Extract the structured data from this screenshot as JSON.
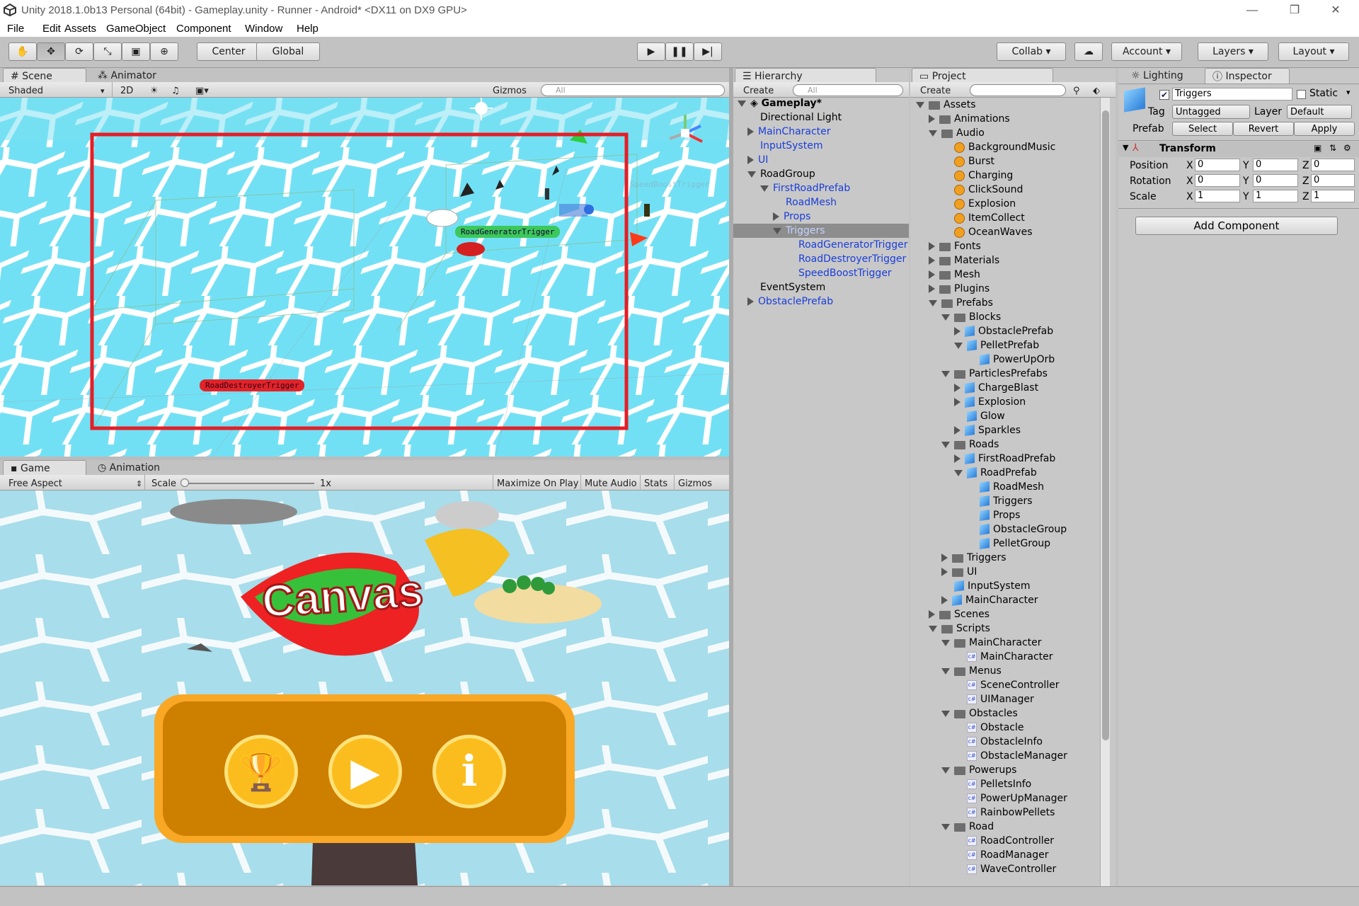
{
  "window": {
    "title": "Unity 2018.1.0b13 Personal (64bit) - Gameplay.unity - Runner - Android* <DX11 on DX9 GPU>"
  },
  "menu": [
    "File",
    "Edit",
    "Assets",
    "GameObject",
    "Component",
    "Window",
    "Help"
  ],
  "toolbar": {
    "pivot": "Center",
    "space": "Global",
    "collab": "Collab",
    "account": "Account",
    "layers": "Layers",
    "layout": "Layout"
  },
  "scene_panel": {
    "tab_scene": "Scene",
    "tab_animator": "Animator",
    "shading": "Shaded",
    "mode2d": "2D",
    "gizmos": "Gizmos",
    "search_placeholder": "All",
    "labels": {
      "road_generator": "RoadGeneratorTrigger",
      "road_destroyer": "RoadDestroyerTrigger",
      "speed_boost": "SpeedBoostTrigger"
    }
  },
  "game_panel": {
    "tab_game": "Game",
    "tab_animation": "Animation",
    "aspect": "Free Aspect",
    "scale_label": "Scale",
    "scale_value": "1x",
    "maximize": "Maximize On Play",
    "mute": "Mute Audio",
    "stats": "Stats",
    "gizmos": "Gizmos",
    "logo_text": "Canvas"
  },
  "hierarchy": {
    "tab": "Hierarchy",
    "create": "Create",
    "search_placeholder": "All",
    "scene": "Gameplay*",
    "items": [
      {
        "label": "Directional Light",
        "indent": 0,
        "arrow": "none",
        "blue": false
      },
      {
        "label": "MainCharacter",
        "indent": 0,
        "arrow": "right",
        "blue": true
      },
      {
        "label": "InputSystem",
        "indent": 0,
        "arrow": "none",
        "blue": true
      },
      {
        "label": "UI",
        "indent": 0,
        "arrow": "right",
        "blue": true
      },
      {
        "label": "RoadGroup",
        "indent": 0,
        "arrow": "down",
        "blue": false
      },
      {
        "label": "FirstRoadPrefab",
        "indent": 1,
        "arrow": "down",
        "blue": true
      },
      {
        "label": "RoadMesh",
        "indent": 2,
        "arrow": "none",
        "blue": true
      },
      {
        "label": "Props",
        "indent": 2,
        "arrow": "right",
        "blue": true
      },
      {
        "label": "Triggers",
        "indent": 2,
        "arrow": "down",
        "blue": true,
        "selected": true
      },
      {
        "label": "RoadGeneratorTrigger",
        "indent": 3,
        "arrow": "none",
        "blue": true
      },
      {
        "label": "RoadDestroyerTrigger",
        "indent": 3,
        "arrow": "none",
        "blue": true
      },
      {
        "label": "SpeedBoostTrigger",
        "indent": 3,
        "arrow": "none",
        "blue": true
      },
      {
        "label": "EventSystem",
        "indent": 0,
        "arrow": "none",
        "blue": false
      },
      {
        "label": "ObstaclePrefab",
        "indent": 0,
        "arrow": "right",
        "blue": true
      }
    ]
  },
  "project": {
    "tab": "Project",
    "create": "Create",
    "items": [
      {
        "label": "Assets",
        "indent": 0,
        "arrow": "down",
        "icon": "folder"
      },
      {
        "label": "Animations",
        "indent": 1,
        "arrow": "right",
        "icon": "folder"
      },
      {
        "label": "Audio",
        "indent": 1,
        "arrow": "down",
        "icon": "folder"
      },
      {
        "label": "BackgroundMusic",
        "indent": 2,
        "arrow": "none",
        "icon": "audio"
      },
      {
        "label": "Burst",
        "indent": 2,
        "arrow": "none",
        "icon": "audio"
      },
      {
        "label": "Charging",
        "indent": 2,
        "arrow": "none",
        "icon": "audio"
      },
      {
        "label": "ClickSound",
        "indent": 2,
        "arrow": "none",
        "icon": "audio"
      },
      {
        "label": "Explosion",
        "indent": 2,
        "arrow": "none",
        "icon": "audio"
      },
      {
        "label": "ItemCollect",
        "indent": 2,
        "arrow": "none",
        "icon": "audio"
      },
      {
        "label": "OceanWaves",
        "indent": 2,
        "arrow": "none",
        "icon": "audio"
      },
      {
        "label": "Fonts",
        "indent": 1,
        "arrow": "right",
        "icon": "folder"
      },
      {
        "label": "Materials",
        "indent": 1,
        "arrow": "right",
        "icon": "folder"
      },
      {
        "label": "Mesh",
        "indent": 1,
        "arrow": "right",
        "icon": "folder"
      },
      {
        "label": "Plugins",
        "indent": 1,
        "arrow": "right",
        "icon": "folder"
      },
      {
        "label": "Prefabs",
        "indent": 1,
        "arrow": "down",
        "icon": "folder"
      },
      {
        "label": "Blocks",
        "indent": 2,
        "arrow": "down",
        "icon": "folder"
      },
      {
        "label": "ObstaclePrefab",
        "indent": 3,
        "arrow": "right",
        "icon": "cube"
      },
      {
        "label": "PelletPrefab",
        "indent": 3,
        "arrow": "down",
        "icon": "cube"
      },
      {
        "label": "PowerUpOrb",
        "indent": 4,
        "arrow": "none",
        "icon": "cube"
      },
      {
        "label": "ParticlesPrefabs",
        "indent": 2,
        "arrow": "down",
        "icon": "folder"
      },
      {
        "label": "ChargeBlast",
        "indent": 3,
        "arrow": "right",
        "icon": "cube"
      },
      {
        "label": "Explosion",
        "indent": 3,
        "arrow": "right",
        "icon": "cube"
      },
      {
        "label": "Glow",
        "indent": 3,
        "arrow": "none",
        "icon": "cube"
      },
      {
        "label": "Sparkles",
        "indent": 3,
        "arrow": "right",
        "icon": "cube"
      },
      {
        "label": "Roads",
        "indent": 2,
        "arrow": "down",
        "icon": "folder"
      },
      {
        "label": "FirstRoadPrefab",
        "indent": 3,
        "arrow": "right",
        "icon": "cube"
      },
      {
        "label": "RoadPrefab",
        "indent": 3,
        "arrow": "down",
        "icon": "cube"
      },
      {
        "label": "RoadMesh",
        "indent": 4,
        "arrow": "none",
        "icon": "cube"
      },
      {
        "label": "Triggers",
        "indent": 4,
        "arrow": "none",
        "icon": "cube"
      },
      {
        "label": "Props",
        "indent": 4,
        "arrow": "none",
        "icon": "cube"
      },
      {
        "label": "ObstacleGroup",
        "indent": 4,
        "arrow": "none",
        "icon": "cube"
      },
      {
        "label": "PelletGroup",
        "indent": 4,
        "arrow": "none",
        "icon": "cube"
      },
      {
        "label": "Triggers",
        "indent": 2,
        "arrow": "right",
        "icon": "folder"
      },
      {
        "label": "UI",
        "indent": 2,
        "arrow": "right",
        "icon": "folder"
      },
      {
        "label": "InputSystem",
        "indent": 2,
        "arrow": "none",
        "icon": "cube"
      },
      {
        "label": "MainCharacter",
        "indent": 2,
        "arrow": "right",
        "icon": "cube"
      },
      {
        "label": "Scenes",
        "indent": 1,
        "arrow": "right",
        "icon": "folder"
      },
      {
        "label": "Scripts",
        "indent": 1,
        "arrow": "down",
        "icon": "folder"
      },
      {
        "label": "MainCharacter",
        "indent": 2,
        "arrow": "down",
        "icon": "folder"
      },
      {
        "label": "MainCharacter",
        "indent": 3,
        "arrow": "none",
        "icon": "cs"
      },
      {
        "label": "Menus",
        "indent": 2,
        "arrow": "down",
        "icon": "folder"
      },
      {
        "label": "SceneController",
        "indent": 3,
        "arrow": "none",
        "icon": "cs"
      },
      {
        "label": "UIManager",
        "indent": 3,
        "arrow": "none",
        "icon": "cs"
      },
      {
        "label": "Obstacles",
        "indent": 2,
        "arrow": "down",
        "icon": "folder"
      },
      {
        "label": "Obstacle",
        "indent": 3,
        "arrow": "none",
        "icon": "cs"
      },
      {
        "label": "ObstacleInfo",
        "indent": 3,
        "arrow": "none",
        "icon": "cs"
      },
      {
        "label": "ObstacleManager",
        "indent": 3,
        "arrow": "none",
        "icon": "cs"
      },
      {
        "label": "Powerups",
        "indent": 2,
        "arrow": "down",
        "icon": "folder"
      },
      {
        "label": "PelletsInfo",
        "indent": 3,
        "arrow": "none",
        "icon": "cs"
      },
      {
        "label": "PowerUpManager",
        "indent": 3,
        "arrow": "none",
        "icon": "cs"
      },
      {
        "label": "RainbowPellets",
        "indent": 3,
        "arrow": "none",
        "icon": "cs"
      },
      {
        "label": "Road",
        "indent": 2,
        "arrow": "down",
        "icon": "folder"
      },
      {
        "label": "RoadController",
        "indent": 3,
        "arrow": "none",
        "icon": "cs"
      },
      {
        "label": "RoadManager",
        "indent": 3,
        "arrow": "none",
        "icon": "cs"
      },
      {
        "label": "WaveController",
        "indent": 3,
        "arrow": "none",
        "icon": "cs"
      }
    ]
  },
  "inspector": {
    "tab_lighting": "Lighting",
    "tab_inspector": "Inspector",
    "object_name": "Triggers",
    "static_label": "Static",
    "tag_label": "Tag",
    "tag_value": "Untagged",
    "layer_label": "Layer",
    "layer_value": "Default",
    "prefab_label": "Prefab",
    "select": "Select",
    "revert": "Revert",
    "apply": "Apply",
    "transform": {
      "title": "Transform",
      "position_label": "Position",
      "rotation_label": "Rotation",
      "scale_label": "Scale",
      "position": {
        "x": "0",
        "y": "0",
        "z": "0"
      },
      "rotation": {
        "x": "0",
        "y": "0",
        "z": "0"
      },
      "scale": {
        "x": "1",
        "y": "1",
        "z": "1"
      }
    },
    "add_component": "Add Component"
  }
}
